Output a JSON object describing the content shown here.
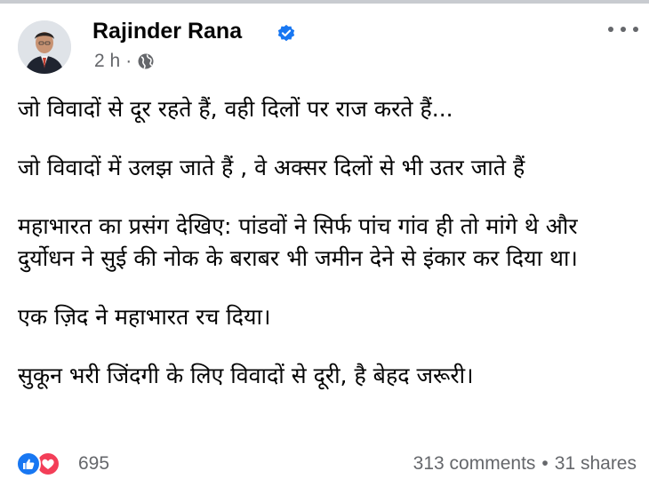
{
  "post": {
    "author": "Rajinder Rana",
    "time": "2 h",
    "separator": "·",
    "paragraphs": [
      "जो विवादों से दूर रहते हैं, वही दिलों पर राज करते हैं...",
      "जो विवादों में उलझ जाते हैं , वे अक्सर दिलों से भी उतर जाते हैं",
      "महाभारत का प्रसंग देखिए: पांडवों ने सिर्फ पांच गांव ही तो मांगे थे और दुर्योधन ने सुई की नोक के बराबर भी जमीन देने से इंकार कर दिया था।",
      "एक ज़िद ने महाभारत रच दिया।",
      "सुकून भरी जिंदगी के लिए विवादों से दूरी, है बेहद जरूरी।"
    ]
  },
  "footer": {
    "reaction_count": "695",
    "comments": "313 comments",
    "shares": "31 shares",
    "separator": "•"
  },
  "icons": {
    "verified": "verified-badge-icon",
    "privacy": "globe-icon",
    "menu": "more-options-icon",
    "reactions": [
      "like-icon",
      "love-icon"
    ]
  },
  "colors": {
    "accent": "#1877f2",
    "love": "#f33e58",
    "secondary_text": "#65676b",
    "text": "#050505"
  }
}
